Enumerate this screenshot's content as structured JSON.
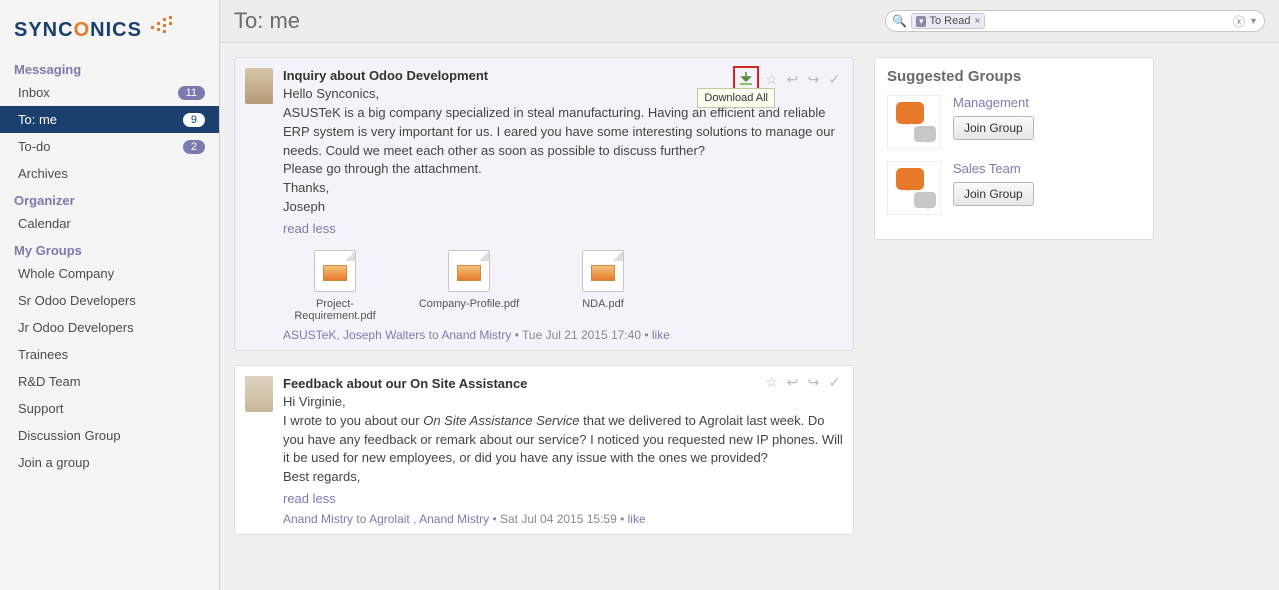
{
  "logo": {
    "part1": "SYNC",
    "part2": "O",
    "part3": "NICS"
  },
  "page_title": "To: me",
  "search": {
    "filter_chip": "To Read",
    "placeholder": ""
  },
  "sidebar": {
    "sections": [
      {
        "title": "Messaging",
        "items": [
          {
            "label": "Inbox",
            "badge": "11"
          },
          {
            "label": "To: me",
            "badge": "9",
            "active": true
          },
          {
            "label": "To-do",
            "badge": "2"
          },
          {
            "label": "Archives"
          }
        ]
      },
      {
        "title": "Organizer",
        "items": [
          {
            "label": "Calendar"
          }
        ]
      },
      {
        "title": "My Groups",
        "items": [
          {
            "label": "Whole Company"
          },
          {
            "label": "Sr Odoo Developers"
          },
          {
            "label": "Jr Odoo Developers"
          },
          {
            "label": "Trainees"
          },
          {
            "label": "R&D Team"
          },
          {
            "label": "Support"
          },
          {
            "label": "Discussion Group"
          },
          {
            "label": "Join a group"
          }
        ]
      }
    ]
  },
  "tooltip_download_all": "Download All",
  "messages": [
    {
      "title": "Inquiry about Odoo Development",
      "greeting": "Hello Synconics,",
      "body": "ASUSTeK is a big company specialized in steal manufacturing. Having an efficient and reliable ERP system is very important for us. I eared you have some interesting solutions to manage our needs. Could we meet each other as soon as possible to discuss further?",
      "line2": "Please go through the attachment.",
      "signoff1": "Thanks,",
      "signoff2": "Joseph",
      "read_less": "read less",
      "attachments": [
        {
          "name": "Project-Requirement.pdf"
        },
        {
          "name": "Company-Profile.pdf"
        },
        {
          "name": "NDA.pdf"
        }
      ],
      "from_company": "ASUSTeK,",
      "from_person": "Joseph Walters",
      "to_label": "to",
      "to_person": "Anand Mistry",
      "timestamp": "Tue Jul 21 2015 17:40",
      "like_label": "like"
    },
    {
      "title": "Feedback about our On Site Assistance",
      "greeting": "Hi Virginie,",
      "body_pre": "I wrote to you about our ",
      "body_em": "On Site Assistance Service",
      "body_post": " that we delivered to Agrolait last week. Do you have any feedback or remark about our service? I noticed you requested new IP phones. Will it be used for new employees, or did you have any issue with the ones we provided?",
      "signoff1": "Best regards,",
      "read_less": "read less",
      "from_person": "Anand Mistry",
      "to_label": "to",
      "to_company": "Agrolait",
      "to_person": "Anand Mistry",
      "timestamp": "Sat Jul 04 2015 15:59",
      "like_label": "like"
    }
  ],
  "suggested": {
    "title": "Suggested Groups",
    "groups": [
      {
        "name": "Management",
        "join": "Join Group"
      },
      {
        "name": "Sales Team",
        "join": "Join Group"
      }
    ]
  }
}
